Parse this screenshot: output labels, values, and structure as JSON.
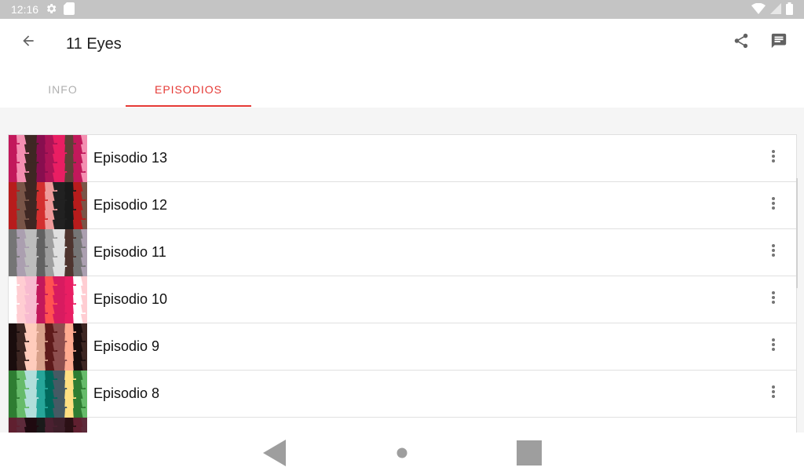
{
  "status_bar": {
    "time": "12:16",
    "icons": [
      "settings-icon",
      "sd-card-icon",
      "wifi-icon",
      "signal-icon",
      "battery-icon"
    ]
  },
  "app_bar": {
    "title": "11 Eyes",
    "icons": [
      "back-arrow-icon",
      "share-icon",
      "comment-icon"
    ]
  },
  "tabs": [
    {
      "label": "INFO",
      "selected": false
    },
    {
      "label": "EPISODIOS",
      "selected": true
    }
  ],
  "colors": {
    "accent": "#e53935",
    "status_bar": "#c4c4c4",
    "inactive_tab": "#b0b0b0"
  },
  "episodes": [
    {
      "title": "Episodio 13",
      "thumb_colors": [
        "#c2185b",
        "#e91e63",
        "#880e4f",
        "#f48fb1",
        "#5d4037",
        "#ad1457",
        "#3e2723"
      ]
    },
    {
      "title": "Episodio 12",
      "thumb_colors": [
        "#3e2723",
        "#b71c1c",
        "#212121",
        "#d32f2f",
        "#795548",
        "#1a1a1a",
        "#ef9a9a"
      ]
    },
    {
      "title": "Episodio 11",
      "thumb_colors": [
        "#9e9e9e",
        "#bdbdbd",
        "#757575",
        "#e0e0e0",
        "#616161",
        "#ab9fb0",
        "#4e342e"
      ]
    },
    {
      "title": "Episodio 10",
      "thumb_colors": [
        "#e91e63",
        "#ff5252",
        "#f8bbd0",
        "#ffffff",
        "#d81b60",
        "#c2185b",
        "#ffcdd2"
      ]
    },
    {
      "title": "Episodio 9",
      "thumb_colors": [
        "#3e2723",
        "#ffab91",
        "#5d1a1a",
        "#ffccbc",
        "#1a0d0d",
        "#8d4e4e",
        "#d7a08a"
      ]
    },
    {
      "title": "Episodio 8",
      "thumb_colors": [
        "#26a69a",
        "#66bb6a",
        "#ffe082",
        "#00695c",
        "#b2dfdb",
        "#2e7d32",
        "#455a64"
      ]
    },
    {
      "title": "",
      "thumb_colors": [
        "#3e1f2a",
        "#1a1a1a",
        "#5d2a3a",
        "#2b1015",
        "#4a2030",
        "#1f0a10",
        "#602030"
      ]
    }
  ],
  "nav_bar": {
    "icons": [
      "nav-back-icon",
      "nav-home-icon",
      "nav-recents-icon"
    ]
  }
}
